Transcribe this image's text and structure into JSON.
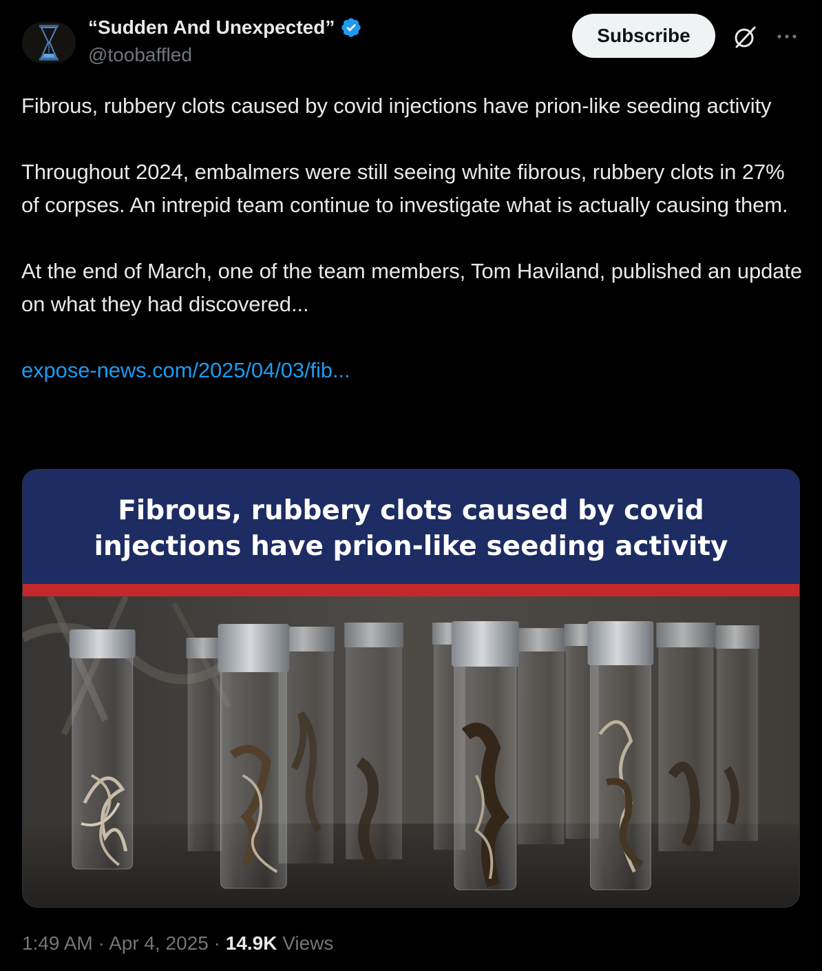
{
  "author": {
    "display_name": "“Sudden And Unexpected”",
    "handle": "@toobaffled",
    "avatar_icon": "hourglass-icon",
    "verified": true,
    "verified_color": "#1d9bf0"
  },
  "actions": {
    "subscribe_label": "Subscribe",
    "grok_icon": "grok-slash-icon",
    "more_icon": "more-dots-icon"
  },
  "post": {
    "paragraph1": "Fibrous, rubbery clots caused by covid injections have prion-like seeding activity",
    "paragraph2": "Throughout 2024, embalmers were still seeing white fibrous, rubbery clots in 27% of corpses.  An intrepid team continue to investigate what is actually causing them.",
    "paragraph3": "At the end of March, one of the team members, Tom Haviland, published an update on what they had discovered...",
    "link_text": "expose-news.com/2025/04/03/fib...",
    "link_color": "#1d9bf0"
  },
  "media": {
    "headline_line1": "Fibrous, rubbery clots caused by covid",
    "headline_line2": "injections have prion-like seeding activity",
    "banner_color": "#1d2c63",
    "strip_color": "#c3292b"
  },
  "footer": {
    "time": "1:49 AM",
    "separator": "·",
    "date": "Apr 4, 2025",
    "views_count": "14.9K",
    "views_label": "Views"
  }
}
